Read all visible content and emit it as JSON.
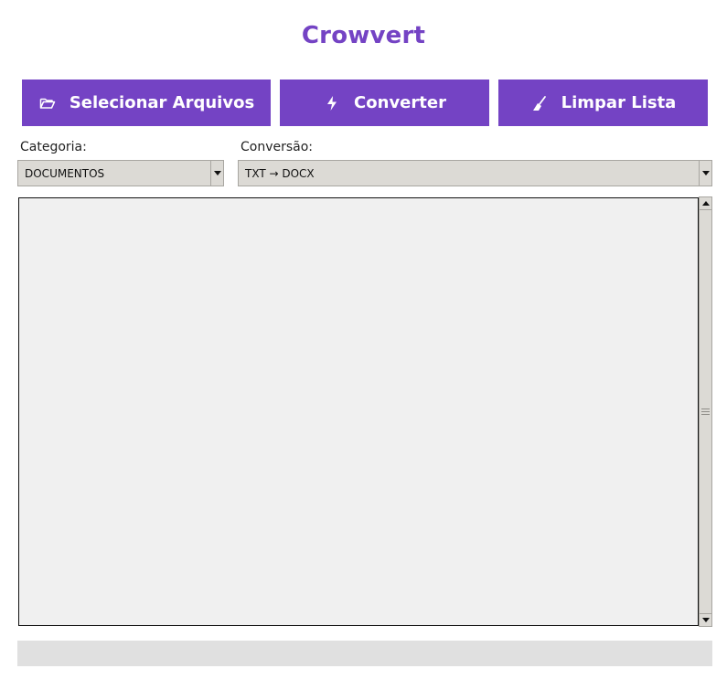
{
  "app": {
    "title": "Crowvert"
  },
  "toolbar": {
    "select_files": {
      "label": "Selecionar Arquivos",
      "icon": "folder-open-icon"
    },
    "convert": {
      "label": "Converter",
      "icon": "lightning-bolt-icon"
    },
    "clear_list": {
      "label": "Limpar Lista",
      "icon": "broom-icon"
    }
  },
  "options": {
    "category_label": "Categoria:",
    "category_value": "DOCUMENTOS",
    "conversion_label": "Conversão:",
    "conversion_value": "TXT → DOCX"
  },
  "file_list": {
    "items": []
  },
  "progress": {
    "value": 0
  },
  "colors": {
    "accent": "#7443c4",
    "list_background": "#f0f0f0",
    "control_background": "#dcdad5",
    "progress_track": "#e0e0e0"
  }
}
